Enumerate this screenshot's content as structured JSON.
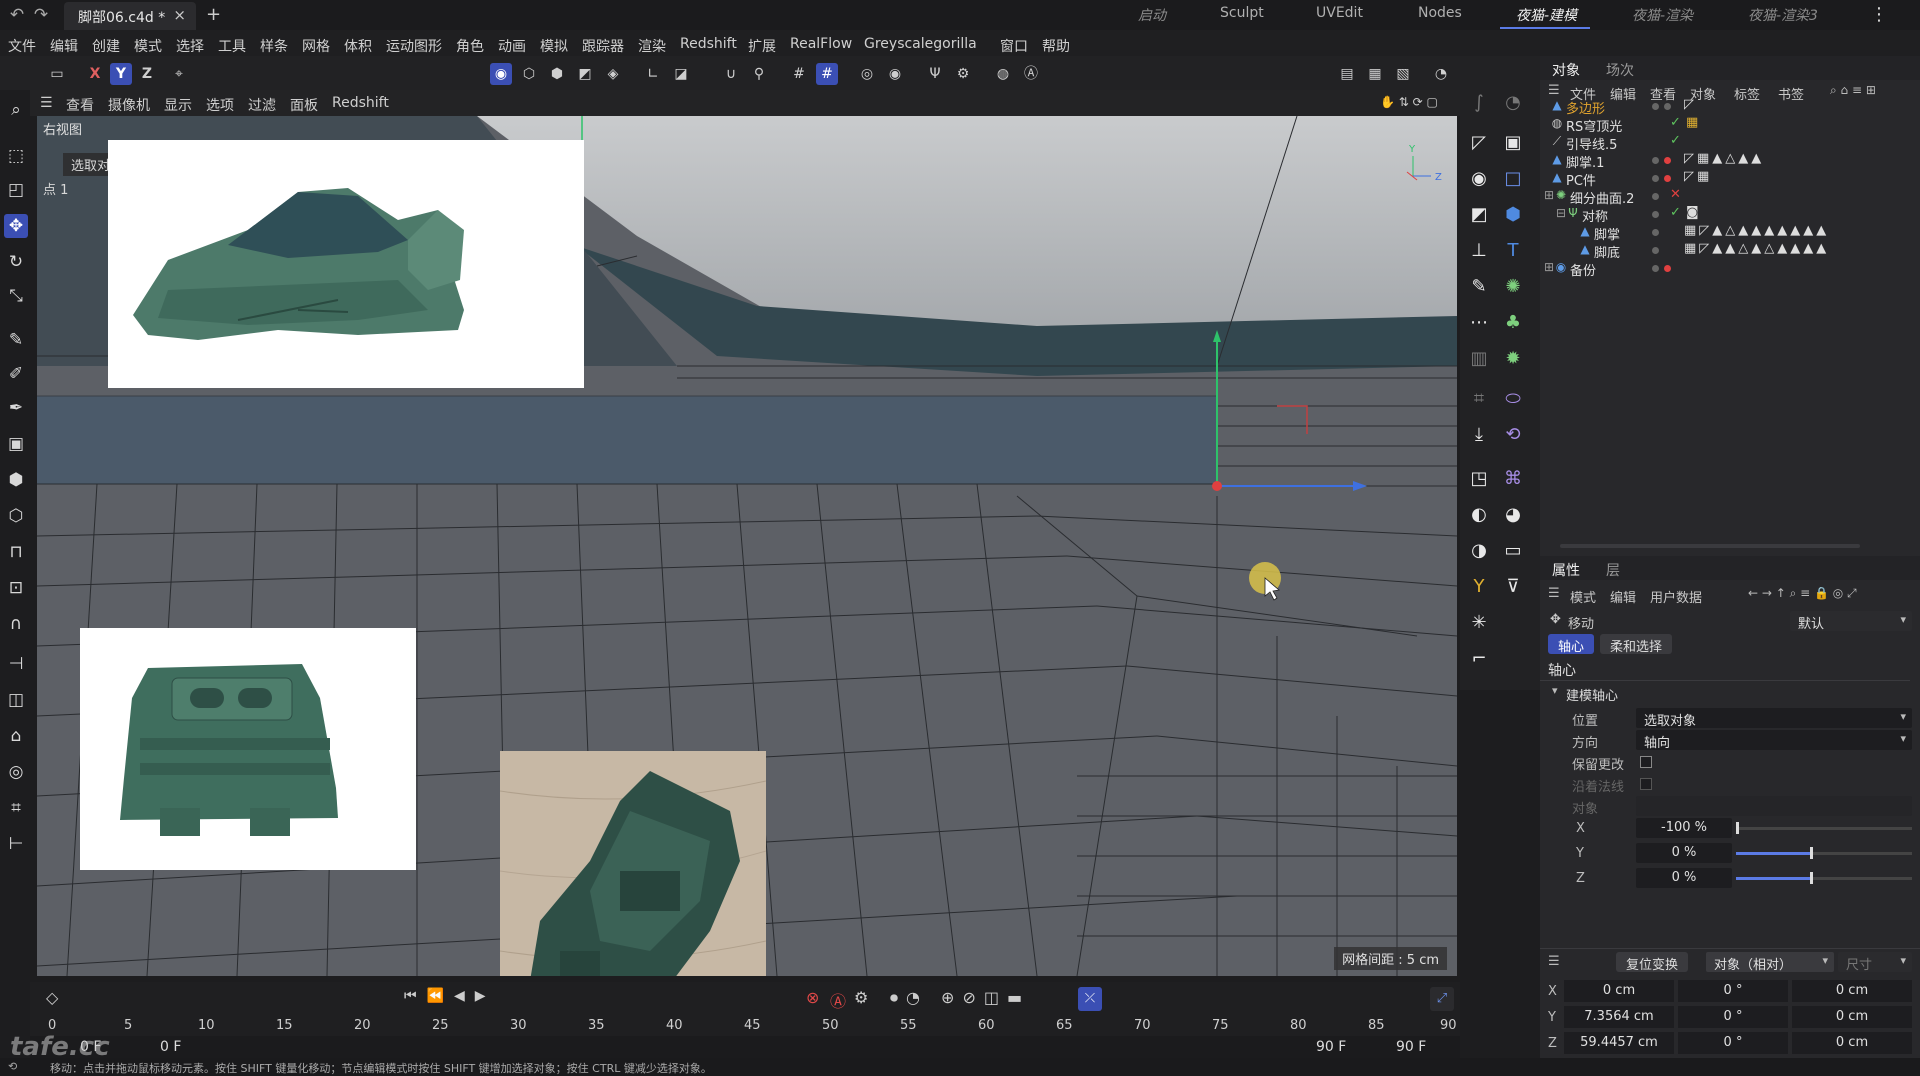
{
  "titlebar": {
    "doc_title": "脚部06.c4d *",
    "close_glyph": "×",
    "new_tab_glyph": "+",
    "undo_glyph": "↶",
    "redo_glyph": "↷",
    "layouts": [
      "启动",
      "Sculpt",
      "UVEdit",
      "Nodes",
      "夜猫-建模",
      "夜猫-渲染",
      "夜猫-渲染3"
    ],
    "more_glyph": "⋮"
  },
  "menubar": [
    "文件",
    "编辑",
    "创建",
    "模式",
    "选择",
    "工具",
    "样条",
    "网格",
    "体积",
    "运动图形",
    "角色",
    "动画",
    "模拟",
    "跟踪器",
    "渲染",
    "Redshift",
    "扩展",
    "RealFlow",
    "Greyscalegorilla",
    "窗口",
    "帮助"
  ],
  "toolbar": {
    "axis_x": "X",
    "axis_y": "Y",
    "axis_z": "Z"
  },
  "viewport_menu": [
    "查看",
    "摄像机",
    "显示",
    "选项",
    "过滤",
    "面板",
    "Redshift"
  ],
  "viewport": {
    "view_name": "右视图",
    "selection_label": "选取对",
    "point_label": "点 1",
    "grid_spacing": "网格间距 : 5 cm"
  },
  "objects_panel": {
    "tabs": [
      "对象",
      "场次"
    ],
    "menu": [
      "文件",
      "编辑",
      "查看",
      "对象",
      "标签",
      "书签"
    ],
    "items": [
      {
        "name": "多边形",
        "color": "#e0a32e"
      },
      {
        "name": "RS穹顶光",
        "color": "#e0e0e0"
      },
      {
        "name": "引导线.5",
        "color": "#e0e0e0"
      },
      {
        "name": "脚掌.1",
        "color": "#e0e0e0"
      },
      {
        "name": "PC件",
        "color": "#e0e0e0"
      },
      {
        "name": "细分曲面.2",
        "color": "#e0e0e0"
      },
      {
        "name": "对称",
        "color": "#e0e0e0"
      },
      {
        "name": "脚掌",
        "color": "#e0e0e0"
      },
      {
        "name": "脚底",
        "color": "#e0e0e0"
      },
      {
        "name": "备份",
        "color": "#e0e0e0"
      }
    ]
  },
  "attributes_panel": {
    "tabs": [
      "属性",
      "层"
    ],
    "menu": [
      "模式",
      "编辑",
      "用户数据"
    ],
    "tool_name": "移动",
    "preset": "默认",
    "subtabs": [
      "轴心",
      "柔和选择"
    ],
    "section": "轴心",
    "group": "建模轴心",
    "position_label": "位置",
    "position_value": "选取对象",
    "direction_label": "方向",
    "direction_value": "轴向",
    "keep_changes_label": "保留更改",
    "along_normal_label": "沿着法线",
    "object_label": "对象",
    "x_label": "X",
    "x_value": "-100 %",
    "x_fraction": -1.0,
    "y_label": "Y",
    "y_value": "0 %",
    "y_fraction": 0.0,
    "z_label": "Z",
    "z_value": "0 %",
    "z_fraction": 0.0
  },
  "coords_panel": {
    "reset_label": "复位变换",
    "mode_label": "对象（相对）",
    "size_label": "尺寸",
    "rows": [
      {
        "axis": "X",
        "pos": "0 cm",
        "rot": "0 °",
        "size": "0 cm"
      },
      {
        "axis": "Y",
        "pos": "7.3564 cm",
        "rot": "0 °",
        "size": "0 cm"
      },
      {
        "axis": "Z",
        "pos": "59.4457 cm",
        "rot": "0 °",
        "size": "0 cm"
      }
    ]
  },
  "timeline": {
    "ticks": [
      "0",
      "5",
      "10",
      "15",
      "20",
      "25",
      "30",
      "35",
      "40",
      "45",
      "50",
      "55",
      "60",
      "65",
      "70",
      "75",
      "80",
      "85",
      "90"
    ],
    "start_frame": "0 F",
    "current_frame": "0 F",
    "end_frame": "90 F",
    "max_frame": "90 F"
  },
  "status": {
    "text": "移动：点击并拖动鼠标移动元素。按住 SHIFT 键量化移动；节点编辑模式时按住 SHIFT 键增加选择对象；按住 CTRL 键减少选择对象。"
  },
  "watermark": "tafe.cc"
}
